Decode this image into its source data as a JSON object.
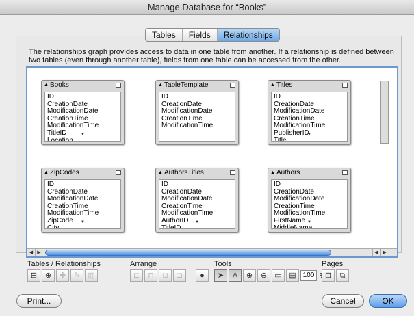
{
  "window": {
    "title": "Manage Database for “Books”"
  },
  "tabs": [
    {
      "label": "Tables",
      "active": false
    },
    {
      "label": "Fields",
      "active": false
    },
    {
      "label": "Relationships",
      "active": true
    }
  ],
  "description": "The relationships graph provides access to data in one table from another. If a relationship is defined between two tables (even through another table), fields from one table can be accessed from the other.",
  "tables": [
    {
      "name": "Books",
      "fields": [
        "ID",
        "CreationDate",
        "ModificationDate",
        "CreationTime",
        "ModificationTime",
        "TitleID",
        "Location"
      ]
    },
    {
      "name": "TableTemplate",
      "fields": [
        "ID",
        "CreationDate",
        "ModificationDate",
        "CreationTime",
        "ModificationTime"
      ]
    },
    {
      "name": "Titles",
      "fields": [
        "ID",
        "CreationDate",
        "ModificationDate",
        "CreationTime",
        "ModificationTime",
        "PublisherID",
        "Title"
      ]
    },
    {
      "name": "ZipCodes",
      "fields": [
        "ID",
        "CreationDate",
        "ModificationDate",
        "CreationTime",
        "ModificationTime",
        "ZipCode",
        "City"
      ]
    },
    {
      "name": "AuthorsTitles",
      "fields": [
        "ID",
        "CreationDate",
        "ModificationDate",
        "CreationTime",
        "ModificationTime",
        "AuthorID",
        "TitleID"
      ]
    },
    {
      "name": "Authors",
      "fields": [
        "ID",
        "CreationDate",
        "ModificationDate",
        "CreationTime",
        "ModificationTime",
        "FirstName",
        "MiddleName"
      ]
    }
  ],
  "toolbar": {
    "tables_label": "Tables / Relationships",
    "arrange_label": "Arrange",
    "tools_label": "Tools",
    "pages_label": "Pages",
    "zoom_value": "100",
    "zoom_unit": "%"
  },
  "buttons": {
    "print": "Print...",
    "cancel": "Cancel",
    "ok": "OK"
  },
  "colors": {
    "accent": "#5e9ee8",
    "canvas_border": "#6a98cf"
  }
}
